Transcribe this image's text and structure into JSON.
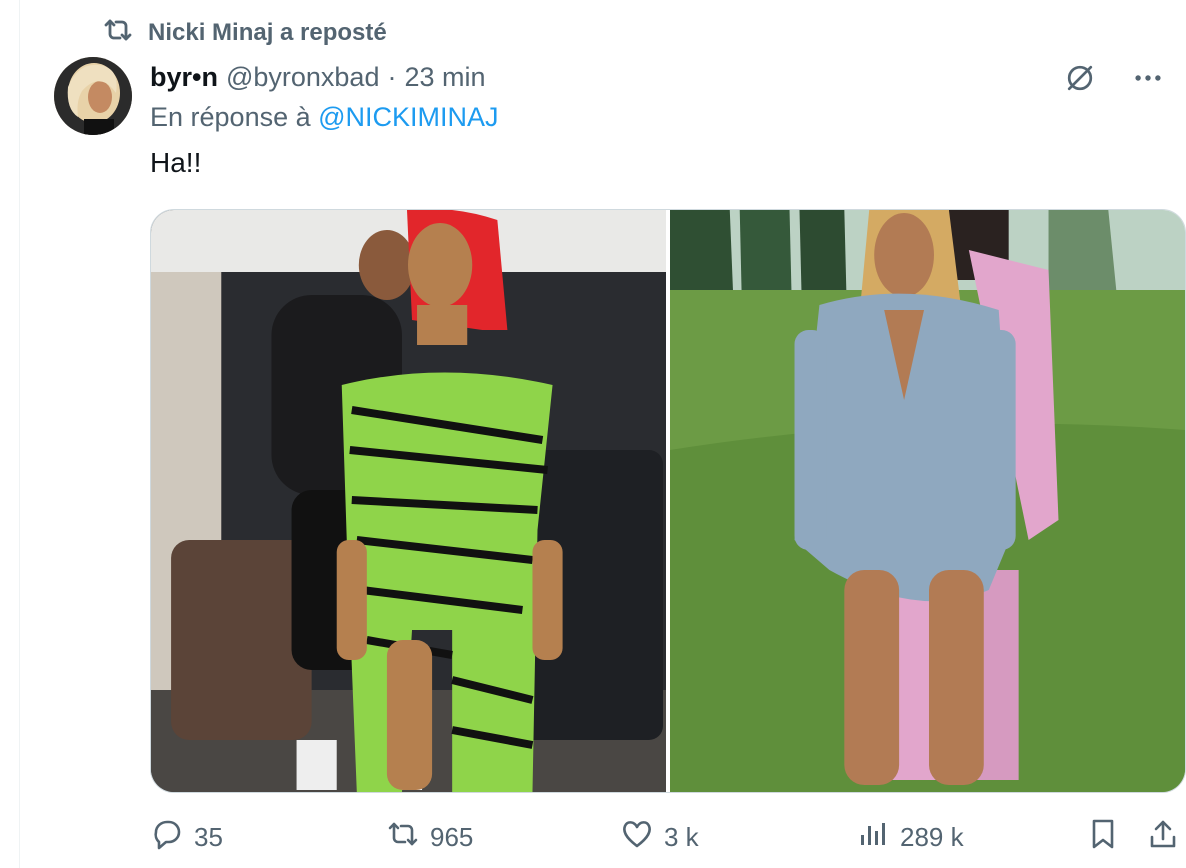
{
  "repost": {
    "icon": "repost-icon",
    "text": "Nicki Minaj a reposté"
  },
  "tweet": {
    "display_name": "byr•n",
    "handle": "@byronxbad",
    "separator": "·",
    "time": "23 min",
    "reply_prefix": "En réponse à",
    "reply_mention": "@NICKIMINAJ",
    "text": "Ha!!",
    "media": [
      {
        "icon": "photo-1",
        "description_hidden": true
      },
      {
        "icon": "photo-2",
        "description_hidden": true
      }
    ]
  },
  "top_icons": [
    "grok-icon",
    "more-icon"
  ],
  "actions": {
    "replies": "35",
    "reposts": "965",
    "likes": "3 k",
    "views": "289 k"
  },
  "colors": {
    "text": "#0f1419",
    "muted": "#536471",
    "link": "#1d9bf0",
    "border": "#cfd9de"
  }
}
